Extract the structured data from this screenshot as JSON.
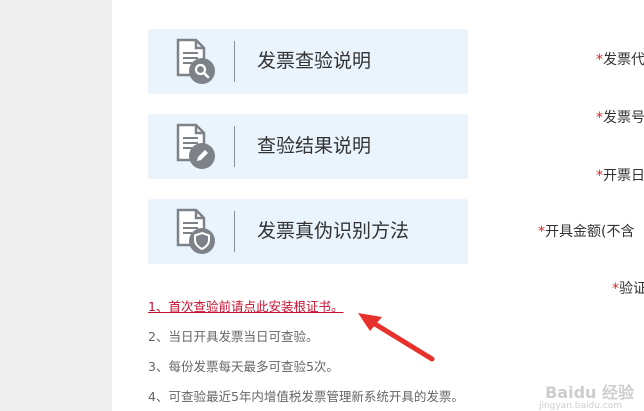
{
  "cards": [
    {
      "label": "发票查验说明",
      "icon": "document-search-icon"
    },
    {
      "label": "查验结果说明",
      "icon": "document-edit-icon"
    },
    {
      "label": "发票真伪识别方法",
      "icon": "document-shield-icon"
    }
  ],
  "form_labels": [
    {
      "star": "*",
      "text": "发票代"
    },
    {
      "star": "*",
      "text": "发票号"
    },
    {
      "star": "*",
      "text": "开票日"
    },
    {
      "star": "*",
      "text": "开具金额(不含"
    },
    {
      "star": "*",
      "text": "验证"
    }
  ],
  "notes": [
    "1、首次查验前请点此安装根证书。",
    "2、当日开具发票当日可查验。",
    "3、每份发票每天最多可查验5次。",
    "4、可查验最近5年内增值税发票管理新系统开具的发票。"
  ],
  "watermark": {
    "main": "Baidu 经验",
    "sub": "jingyan.baidu.com"
  },
  "colors": {
    "card_bg": "#eaf4fd",
    "icon_gray": "#7d8288",
    "link_red": "#c8102e",
    "star_red": "#e02424",
    "arrow_red": "#e8312c"
  }
}
